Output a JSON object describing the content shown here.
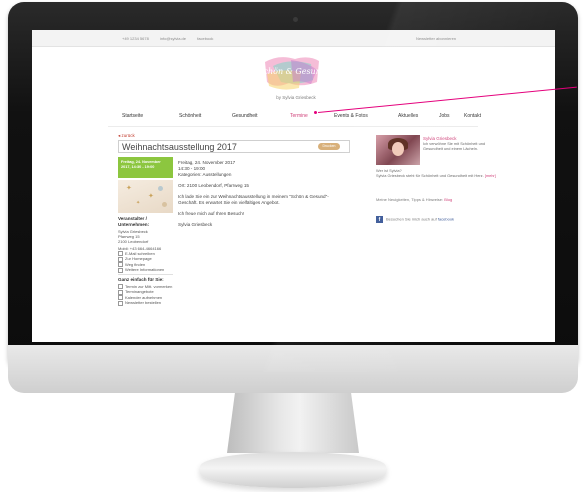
{
  "topbar": {
    "left_items": [
      "+49 1234 5678",
      "info@sylvia.de",
      "facebook"
    ],
    "right_item": "Newsletter abonnieren"
  },
  "brand": {
    "logo_text": "Schön & Gesund",
    "subtitle": "by Sylvia Griesbeck"
  },
  "nav": {
    "items": [
      "Startseite",
      "Schönheit",
      "Gesundheit",
      "Termine",
      "Events & Fotos",
      "Aktuelles",
      "Jobs",
      "Kontakt"
    ],
    "active_index": 3
  },
  "event": {
    "back_label": "zurück",
    "title": "Weihnachtsausstellung 2017",
    "print_label": "Drucken",
    "date_box": "Freitag, 24. November 2017, 14:30 - 19:00",
    "details": [
      "Freitag, 24. November 2017",
      "14:30 - 19:00",
      "Kategorien: Ausstellungen",
      "Ort: 2100 Leobendorf, Pfarrweg 15",
      "Ich lade Sie ein zur Weihnachtsausstellung in meinem \"Schön & Gesund\"-Geschäft. Es erwartet Sie ein vielfältiges Angebot.",
      "Ich freue mich auf Ihren Besuch!",
      "Sylvia Griesbeck"
    ]
  },
  "organizer": {
    "heading": "Veranstalter / Unternehmen:",
    "name": "Sylvia Griesbeck",
    "street": "Pfarrweg 15",
    "city": "2100 Leobendorf",
    "phone": "Mobil: +43 664-4664166",
    "links": [
      "E-Mail schreiben",
      "Zur Homepage",
      "Weg finden",
      "Weitere Informationen"
    ]
  },
  "quick": {
    "heading": "Ganz einfach für Sie:",
    "links": [
      "Termin zur Mitt. vormerken",
      "Terminangebote",
      "Kalender aufnehmen",
      "Newsletter bestellen"
    ]
  },
  "author": {
    "name": "Sylvia Griesbeck",
    "text": "Ich verwöhne Sie mit Schönheit und Gesundheit und einem Lächeln.",
    "who_label": "Wer ist Sylvia?",
    "who_text": "Sylvia Griesbeck steht für Schönheit und Gesundheit mit Herz. ",
    "more_link": "[mehr]"
  },
  "tips": {
    "prefix": "Meine Neuigkeiten, Tipps & Hinweise: ",
    "link": "Blog"
  },
  "facebook": {
    "icon": "f",
    "prefix": "Besuchen Sie mich auch auf ",
    "link": "facebook"
  },
  "colors": {
    "accent": "#d0427a",
    "green": "#8cc63f",
    "callout": "#e4007c",
    "facebook": "#3b5998"
  }
}
